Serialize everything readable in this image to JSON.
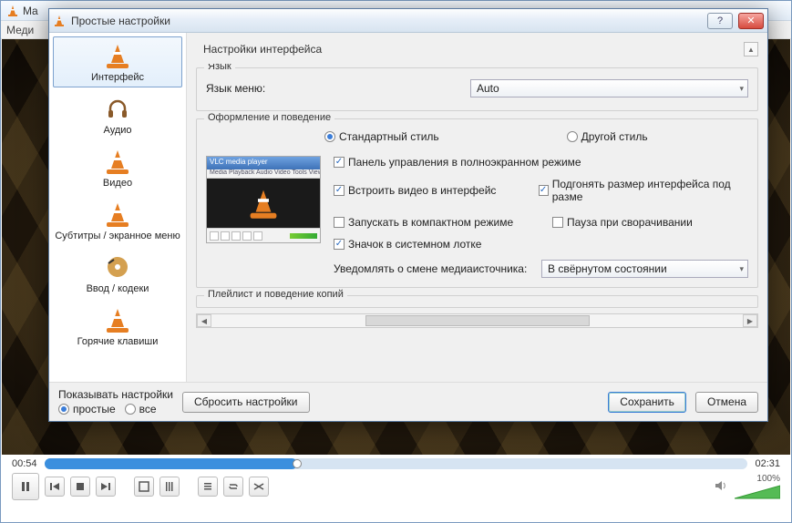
{
  "main": {
    "title_prefix": "Ma",
    "menu_prefix": "Меди"
  },
  "player": {
    "time_current": "00:54",
    "time_total": "02:31",
    "volume_pct": "100%"
  },
  "dialog": {
    "title": "Простые настройки",
    "sidebar": [
      {
        "label": "Интерфейс",
        "key": "interface",
        "selected": true
      },
      {
        "label": "Аудио",
        "key": "audio"
      },
      {
        "label": "Видео",
        "key": "video"
      },
      {
        "label": "Субтитры / экранное меню",
        "key": "subs"
      },
      {
        "label": "Ввод / кодеки",
        "key": "input"
      },
      {
        "label": "Горячие клавиши",
        "key": "hotkeys"
      }
    ],
    "page_title": "Настройки интерфейса",
    "groups": {
      "language": {
        "title": "Язык",
        "menu_label": "Язык меню:",
        "menu_value": "Auto"
      },
      "look": {
        "title": "Оформление и поведение",
        "style_native": "Стандартный стиль",
        "style_custom": "Другой стиль",
        "preview_title": "VLC media player",
        "preview_menu": "Media Playback Audio Video Tools View Help",
        "chk_fullscreen": "Панель управления в полноэкранном режиме",
        "chk_embed": "Встроить видео в интерфейс",
        "chk_resize": "Подгонять размер интерфейса под разме",
        "chk_compact": "Запускать в компактном режиме",
        "chk_pause": "Пауза при сворачивании",
        "chk_tray": "Значок в системном лотке",
        "notify_label": "Уведомлять о смене медиаисточника:",
        "notify_value": "В свёрнутом состоянии"
      },
      "playlist": {
        "title": "Плейлист и поведение копий"
      }
    },
    "footer": {
      "show_settings": "Показывать настройки",
      "simple": "простые",
      "all": "все",
      "reset": "Сбросить настройки",
      "save": "Сохранить",
      "cancel": "Отмена"
    }
  }
}
